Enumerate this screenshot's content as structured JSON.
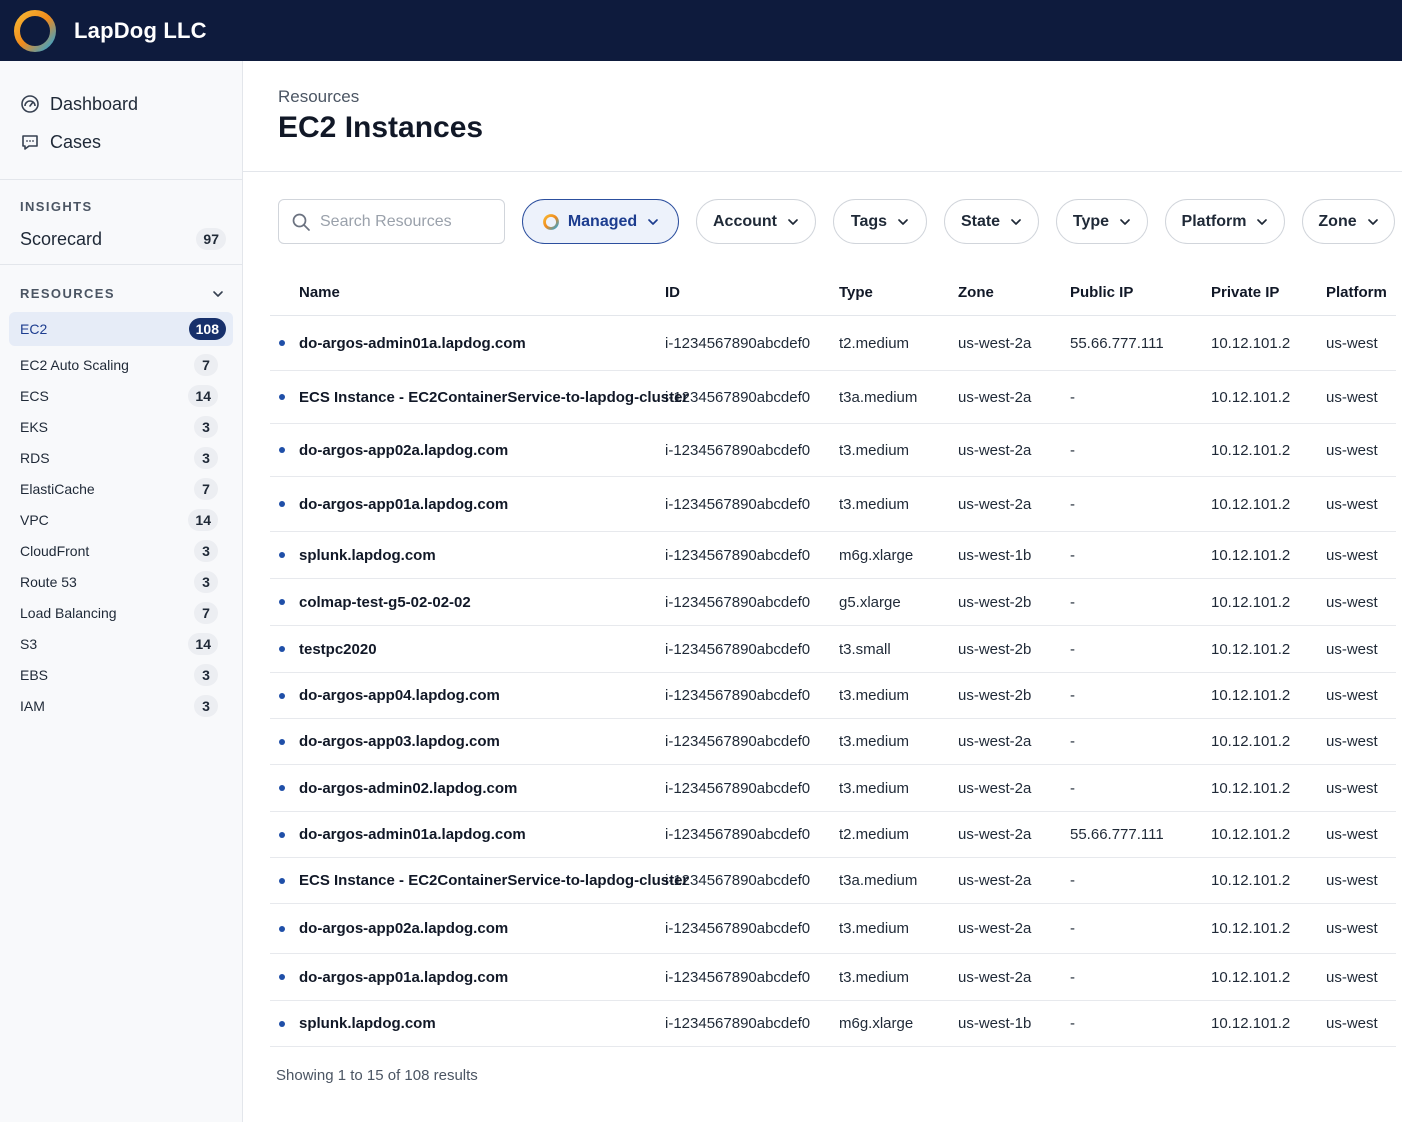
{
  "app": {
    "brand": "LapDog LLC"
  },
  "sidebar": {
    "nav": [
      {
        "label": "Dashboard",
        "icon": "dashboard-icon"
      },
      {
        "label": "Cases",
        "icon": "chat-icon"
      }
    ],
    "insights": {
      "title": "INSIGHTS",
      "scorecard_label": "Scorecard",
      "scorecard_count": "97"
    },
    "resources": {
      "title": "RESOURCES",
      "items": [
        {
          "label": "EC2",
          "count": "108",
          "active": true
        },
        {
          "label": "EC2 Auto Scaling",
          "count": "7"
        },
        {
          "label": "ECS",
          "count": "14"
        },
        {
          "label": "EKS",
          "count": "3"
        },
        {
          "label": "RDS",
          "count": "3"
        },
        {
          "label": "ElastiCache",
          "count": "7"
        },
        {
          "label": "VPC",
          "count": "14"
        },
        {
          "label": "CloudFront",
          "count": "3"
        },
        {
          "label": "Route 53",
          "count": "3"
        },
        {
          "label": "Load Balancing",
          "count": "7"
        },
        {
          "label": "S3",
          "count": "14"
        },
        {
          "label": "EBS",
          "count": "3"
        },
        {
          "label": "IAM",
          "count": "3"
        }
      ]
    }
  },
  "header": {
    "breadcrumb": "Resources",
    "title": "EC2 Instances"
  },
  "filters": {
    "search_placeholder": "Search Resources",
    "managed": "Managed",
    "account": "Account",
    "tags": "Tags",
    "state": "State",
    "type": "Type",
    "platform": "Platform",
    "zone": "Zone"
  },
  "table": {
    "columns": [
      "Name",
      "ID",
      "Type",
      "Zone",
      "Public IP",
      "Private IP",
      "Platform"
    ],
    "rows": [
      [
        "do-argos-admin01a.lapdog.com",
        "i-1234567890abcdef0",
        "t2.medium",
        "us-west-2a",
        "55.66.777.111",
        "10.12.101.2",
        "us-west"
      ],
      [
        "ECS Instance - EC2ContainerService-to-lapdog-cluster",
        "i-1234567890abcdef0",
        "t3a.medium",
        "us-west-2a",
        "-",
        "10.12.101.2",
        "us-west"
      ],
      [
        "do-argos-app02a.lapdog.com",
        "i-1234567890abcdef0",
        "t3.medium",
        "us-west-2a",
        "-",
        "10.12.101.2",
        "us-west"
      ],
      [
        "do-argos-app01a.lapdog.com",
        "i-1234567890abcdef0",
        "t3.medium",
        "us-west-2a",
        "-",
        "10.12.101.2",
        "us-west"
      ],
      [
        "splunk.lapdog.com",
        "i-1234567890abcdef0",
        "m6g.xlarge",
        "us-west-1b",
        "-",
        "10.12.101.2",
        "us-west"
      ],
      [
        "colmap-test-g5-02-02-02",
        "i-1234567890abcdef0",
        "g5.xlarge",
        "us-west-2b",
        "-",
        "10.12.101.2",
        "us-west"
      ],
      [
        "testpc2020",
        "i-1234567890abcdef0",
        "t3.small",
        "us-west-2b",
        "-",
        "10.12.101.2",
        "us-west"
      ],
      [
        "do-argos-app04.lapdog.com",
        "i-1234567890abcdef0",
        "t3.medium",
        "us-west-2b",
        "-",
        "10.12.101.2",
        "us-west"
      ],
      [
        "do-argos-app03.lapdog.com",
        "i-1234567890abcdef0",
        "t3.medium",
        "us-west-2a",
        "-",
        "10.12.101.2",
        "us-west"
      ],
      [
        "do-argos-admin02.lapdog.com",
        "i-1234567890abcdef0",
        "t3.medium",
        "us-west-2a",
        "-",
        "10.12.101.2",
        "us-west"
      ],
      [
        "do-argos-admin01a.lapdog.com",
        "i-1234567890abcdef0",
        "t2.medium",
        "us-west-2a",
        "55.66.777.111",
        "10.12.101.2",
        "us-west"
      ],
      [
        "ECS Instance - EC2ContainerService-to-lapdog-cluster",
        "i-1234567890abcdef0",
        "t3a.medium",
        "us-west-2a",
        "-",
        "10.12.101.2",
        "us-west"
      ],
      [
        "do-argos-app02a.lapdog.com",
        "i-1234567890abcdef0",
        "t3.medium",
        "us-west-2a",
        "-",
        "10.12.101.2",
        "us-west"
      ],
      [
        "do-argos-app01a.lapdog.com",
        "i-1234567890abcdef0",
        "t3.medium",
        "us-west-2a",
        "-",
        "10.12.101.2",
        "us-west"
      ],
      [
        "splunk.lapdog.com",
        "i-1234567890abcdef0",
        "m6g.xlarge",
        "us-west-1b",
        "-",
        "10.12.101.2",
        "us-west"
      ]
    ]
  },
  "footer": {
    "summary": "Showing 1 to 15 of 108 results"
  },
  "colors": {
    "topbar": "#0e1b3d",
    "accent": "#17306b",
    "status_dot": "#1f4fa8"
  }
}
